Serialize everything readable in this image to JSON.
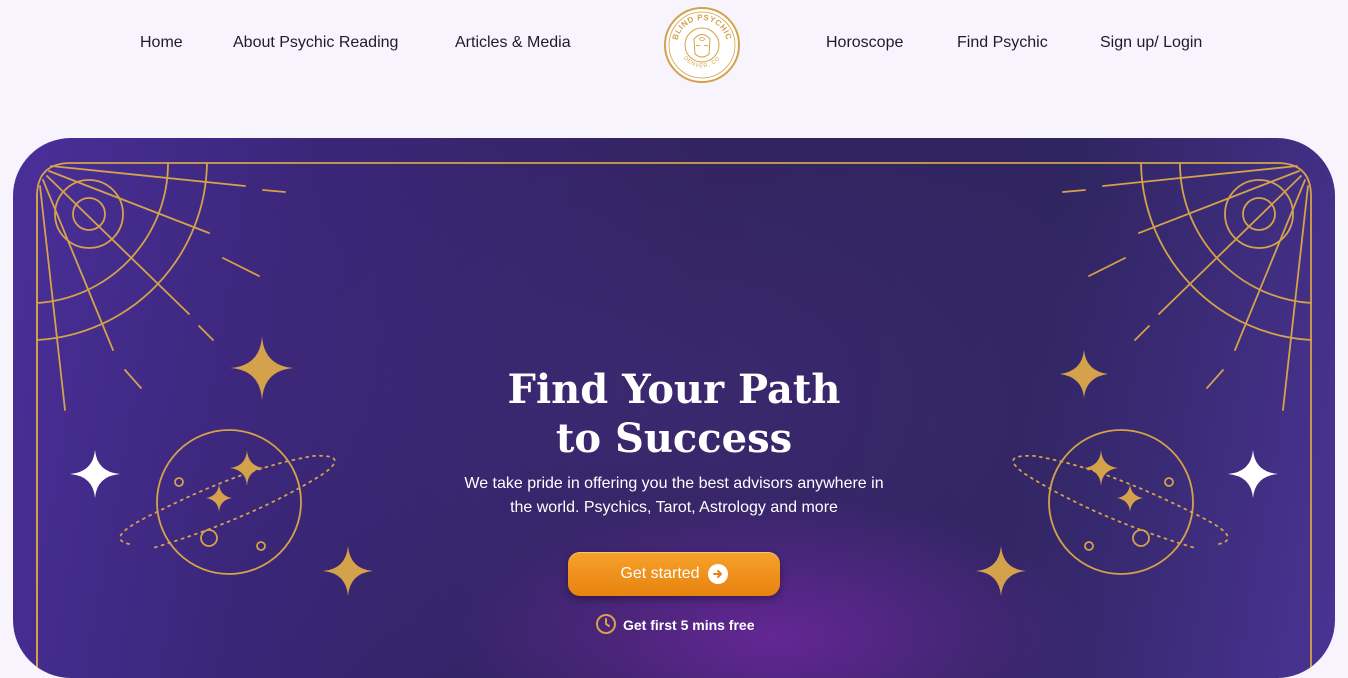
{
  "nav": {
    "left": [
      "Home",
      "About Psychic Reading",
      "Articles & Media"
    ],
    "right": [
      "Horoscope",
      "Find Psychic",
      "Sign up/ Login"
    ]
  },
  "logo": {
    "text_top": "BLIND PSYCHIC",
    "text_bottom": "DENVER, CO",
    "icon": "psychic-face-logo"
  },
  "hero": {
    "title_line1": "Find Your Path",
    "title_line2": "to Success",
    "subtitle_line1": "We take pride in offering you the best advisors anywhere in",
    "subtitle_line2": "the world. Psychics, Tarot, Astrology and more",
    "cta_label": "Get started",
    "cta_icon": "arrow-right-circle-icon",
    "free_label": "Get first 5 mins free",
    "free_icon": "clock-icon"
  },
  "colors": {
    "page_bg": "#f7f4fd",
    "hero_bg": "#2e2258",
    "gold": "#d4a24a",
    "cta": "#f29a1f"
  }
}
